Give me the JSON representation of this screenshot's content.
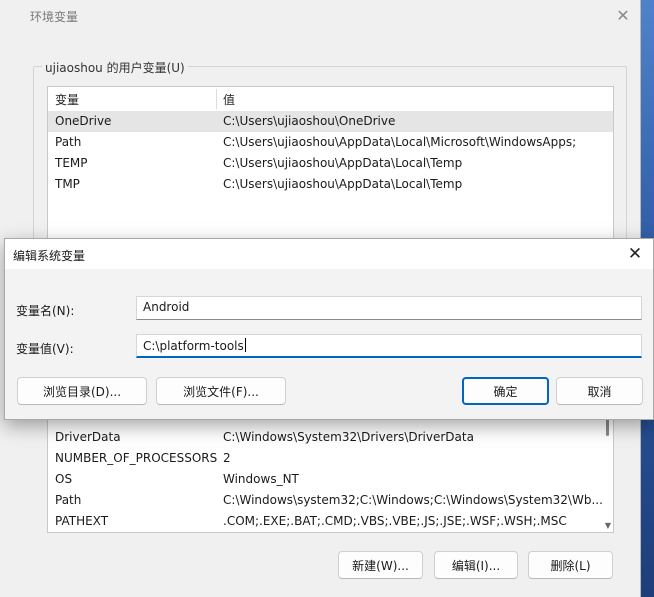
{
  "env_window": {
    "title": "环境变量",
    "close_glyph": "✕",
    "user_group_label": "ujiaoshou 的用户变量(U)",
    "columns": [
      "变量",
      "值"
    ],
    "user_vars": [
      {
        "name": "OneDrive",
        "value": "C:\\Users\\ujiaoshou\\OneDrive"
      },
      {
        "name": "Path",
        "value": "C:\\Users\\ujiaoshou\\AppData\\Local\\Microsoft\\WindowsApps;"
      },
      {
        "name": "TEMP",
        "value": "C:\\Users\\ujiaoshou\\AppData\\Local\\Temp"
      },
      {
        "name": "TMP",
        "value": "C:\\Users\\ujiaoshou\\AppData\\Local\\Temp"
      }
    ],
    "system_vars": [
      {
        "name": "DriverData",
        "value": "C:\\Windows\\System32\\Drivers\\DriverData"
      },
      {
        "name": "NUMBER_OF_PROCESSORS",
        "value": "2"
      },
      {
        "name": "OS",
        "value": "Windows_NT"
      },
      {
        "name": "Path",
        "value": "C:\\Windows\\system32;C:\\Windows;C:\\Windows\\System32\\Wb..."
      },
      {
        "name": "PATHEXT",
        "value": ".COM;.EXE;.BAT;.CMD;.VBS;.VBE;.JS;.JSE;.WSF;.WSH;.MSC"
      }
    ],
    "buttons": {
      "new": "新建(W)...",
      "edit": "编辑(I)...",
      "delete": "删除(L)"
    }
  },
  "edit_dialog": {
    "title": "编辑系统变量",
    "close_glyph": "✕",
    "name_label": "变量名(N):",
    "name_value": "Android",
    "value_label": "变量值(V):",
    "value_value": "C:\\platform-tools",
    "buttons": {
      "browse_dir": "浏览目录(D)...",
      "browse_file": "浏览文件(F)...",
      "ok": "确定",
      "cancel": "取消"
    }
  }
}
